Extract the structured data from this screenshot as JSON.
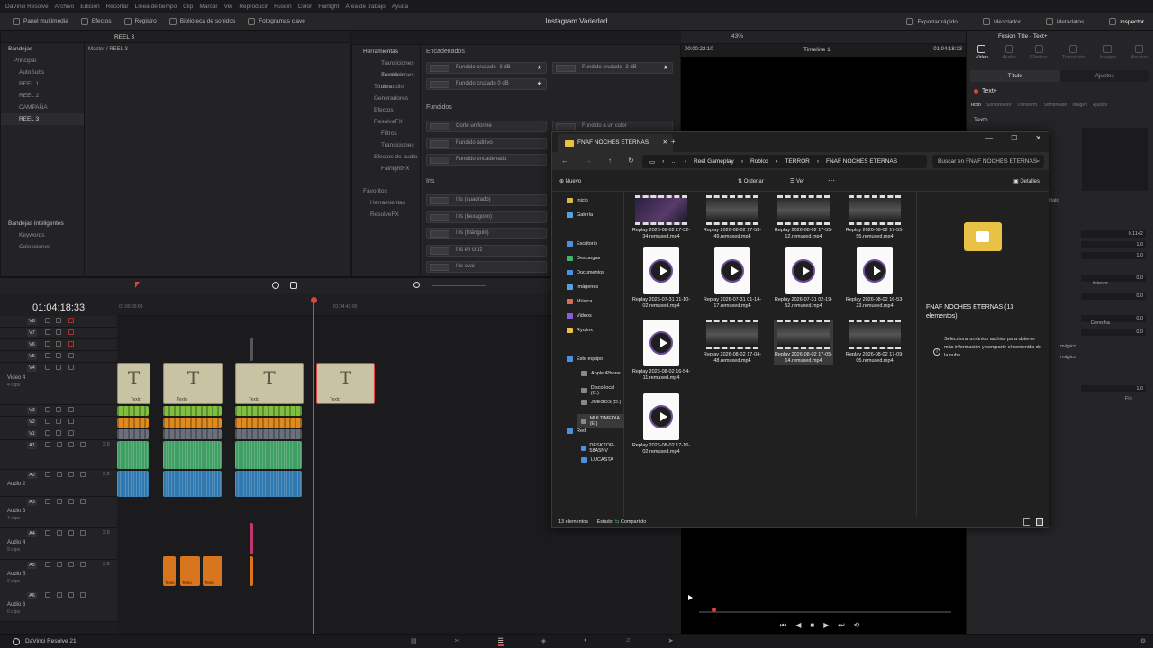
{
  "menu": [
    "DaVinci Resolve",
    "Archivo",
    "Edición",
    "Recortar",
    "Línea de tiempo",
    "Clip",
    "Marcar",
    "Ver",
    "Reproducir",
    "Fusion",
    "Color",
    "Fairlight",
    "Área de trabajo",
    "Ayuda"
  ],
  "toolbar": {
    "left": [
      "Panel multimedia",
      "Efectos",
      "Registro",
      "Biblioteca de sonidos",
      "Fotogramas clave"
    ],
    "title": "Instagram Variedad",
    "right": [
      "Exportar rápido",
      "Mezclador",
      "Metadatos",
      "Inspector"
    ]
  },
  "media_pool": {
    "current": "REEL 3",
    "bins_label": "Bandejas",
    "path": "Master / REEL 3",
    "bins": [
      "Principal",
      "AutoSubs",
      "REEL 1",
      "REEL 2",
      "CAMPAÑA",
      "REEL 3"
    ],
    "smart_bins_label": "Bandejas inteligentes",
    "smart_bins": [
      "Keywords",
      "Colecciones"
    ]
  },
  "effects": {
    "header": "Herramientas",
    "list": [
      "Transiciones de video",
      "Transiciones de audio",
      "Títulos",
      "Generadores",
      "Efectos",
      "ResolveFX",
      "Filtros",
      "Transiciones",
      "Efectos de audio",
      "FairlightFX"
    ],
    "favorites_label": "Favoritos",
    "favorites": [
      "Herramientas",
      "ResolveFX"
    ],
    "sections": [
      {
        "title": "Encadenados",
        "cards": [
          "Fundido cruzado -3 dB",
          "Fundido cruzado -3 dB",
          "Fundido cruzado 0 dB"
        ]
      },
      {
        "title": "Fundidos",
        "cards": [
          "Corte uniforme",
          "Fundido a un color",
          "Fundido aditivo",
          "Fundido encadenado"
        ]
      },
      {
        "title": "Iris",
        "cards": [
          "Iris (cuadrado)",
          "Iris (hexágono)",
          "Iris (triángulo)",
          "Iris en cruz",
          "Iris oval"
        ]
      }
    ]
  },
  "viewer": {
    "zoom": "43%",
    "timeline_name": "Timeline 1",
    "timecode_left": "00:00:22:10",
    "timecode_right": "01:04:18:33"
  },
  "inspector": {
    "title": "Fusion Title - Text+",
    "tabs": [
      "Video",
      "Audio",
      "Efectos",
      "Transición",
      "Imagen",
      "Archivo"
    ],
    "subtabs": [
      "Título",
      "Ajustes"
    ],
    "node": "Text+",
    "node_tabs": [
      "Texto",
      "Sombreador",
      "Transform.",
      "Sombreado",
      "Imagen",
      "Ajustes"
    ],
    "section": "Texto",
    "values": [
      "0.1142",
      "1.0",
      "1.0",
      "0.0",
      "0.0",
      "0.0",
      "0.0",
      "1.0"
    ],
    "labels": [
      "Italic",
      "Interior",
      "Derecha",
      "mágico",
      "mágico",
      "Fin"
    ]
  },
  "timeline": {
    "timecode": "01:04:18:33",
    "ruler": [
      "01:00:00:00",
      "01:04:42:00"
    ],
    "video_tracks": [
      {
        "id": "V8"
      },
      {
        "id": "V7"
      },
      {
        "id": "V6"
      },
      {
        "id": "V5"
      },
      {
        "id": "V4",
        "name": "Video 4",
        "clips": "4 clips"
      },
      {
        "id": "V3"
      },
      {
        "id": "V2"
      },
      {
        "id": "V1"
      }
    ],
    "audio_tracks": [
      {
        "id": "A1",
        "level": "2.0"
      },
      {
        "id": "A2",
        "name": "Audio 2",
        "level": "2.0"
      },
      {
        "id": "A3",
        "name": "Audio 3",
        "clips": "7 clips"
      },
      {
        "id": "A4",
        "name": "Audio 4",
        "clips": "9 clips",
        "level": "2.0"
      },
      {
        "id": "A5",
        "name": "Audio 5",
        "clips": "6 clips",
        "level": "2.0"
      },
      {
        "id": "A6",
        "name": "Audio 6",
        "clips": "0 clips"
      }
    ],
    "text_clip_label": "Texto",
    "audio_clip_label": "Texto"
  },
  "explorer": {
    "tab_title": "FNAF NOCHES ETERNAS",
    "breadcrumb": [
      "Reel Gameplay",
      "Roblox",
      "TERROR",
      "FNAF NOCHES ETERNAS"
    ],
    "search_placeholder": "Buscar en FNAF NOCHES ETERNAS",
    "commands": [
      "Nuevo",
      "Ordenar",
      "Ver",
      "Detalles"
    ],
    "nav": [
      "Inicio",
      "Galería",
      "Escritorio",
      "Descargas",
      "Documentos",
      "Imágenes",
      "Música",
      "Videos",
      "Ryujinx",
      "Este equipo",
      "Apple iPhone",
      "Disco local (C:)",
      "JUEGOS (D:)",
      "MULTIMEDIA (E:)",
      "Red",
      "DESKTOP-58A5NV",
      "LUCASTA"
    ],
    "files": [
      {
        "name": "Replay 2026-08-02 17-52-34.remuxed.mp4",
        "kind": "video"
      },
      {
        "name": "Replay 2026-08-02 17-53-49.remuxed.mp4",
        "kind": "video"
      },
      {
        "name": "Replay 2026-08-02 17-55-12.remuxed.mp4",
        "kind": "video"
      },
      {
        "name": "Replay 2026-08-02 17-55-55.remuxed.mp4",
        "kind": "video"
      },
      {
        "name": "Replay 2026-07-31 01-10-02.remuxed.mp4",
        "kind": "doc"
      },
      {
        "name": "Replay 2026-07-31 01-14-17.remuxed.mp4",
        "kind": "doc"
      },
      {
        "name": "Replay 2026-07-31 02-19-52.remuxed.mp4",
        "kind": "doc"
      },
      {
        "name": "Replay 2026-08-02 16-53-23.remuxed.mp4",
        "kind": "doc"
      },
      {
        "name": "Replay 2026-08-02 16-54-11.remuxed.mp4",
        "kind": "doc"
      },
      {
        "name": "Replay 2026-08-02 17-04-48.remuxed.mp4",
        "kind": "video"
      },
      {
        "name": "Replay 2026-08-02 17-05-14.remuxed.mp4",
        "kind": "video"
      },
      {
        "name": "Replay 2026-08-02 17-09-05.remuxed.mp4",
        "kind": "video"
      },
      {
        "name": "Replay 2026-08-02 17-16-02.remuxed.mp4",
        "kind": "doc"
      }
    ],
    "details_title": "FNAF NOCHES ETERNAS (13 elementos)",
    "details_hint": "Selecciona un único archivo para obtener más información y compartir el contenido de la nube.",
    "status_count": "13 elementos",
    "status_state": "Estado:",
    "status_shared": "Compartido"
  },
  "bottom": {
    "app": "DaVinci Resolve 21"
  },
  "colors": {
    "accent": "#e0413b",
    "playhead": "#e0413b",
    "video_clip_green": "#7fbf3f",
    "video_clip_orange": "#e08a1e",
    "audio_green": "#3f9e63",
    "audio_blue": "#2f78b0",
    "audio_orange": "#d9751d",
    "folder": "#e8c145"
  }
}
